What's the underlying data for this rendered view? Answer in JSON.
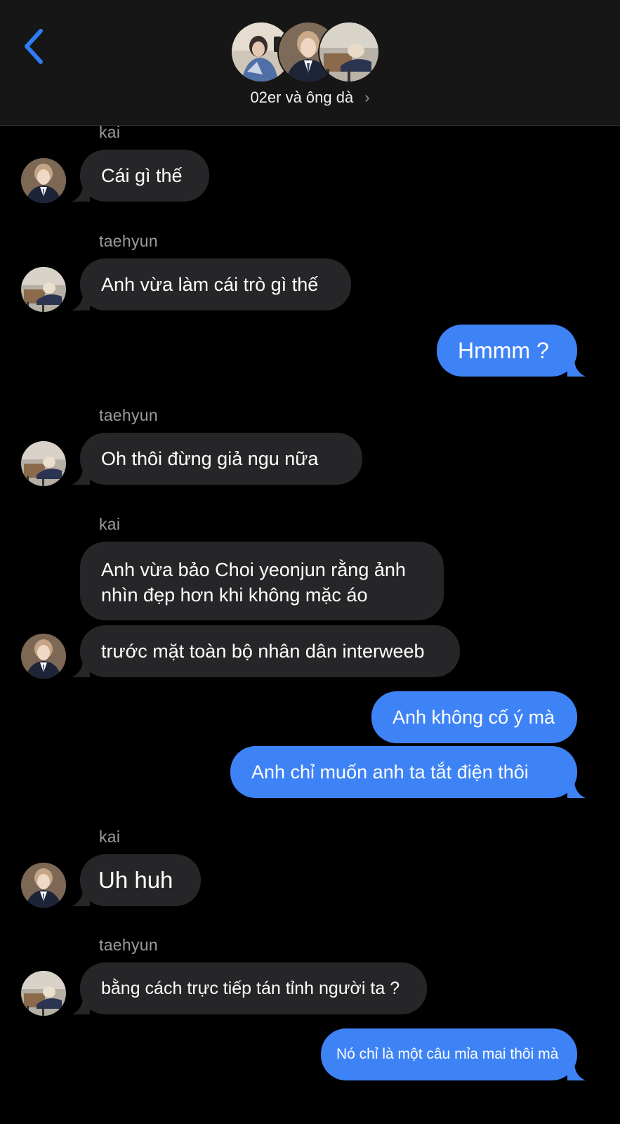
{
  "header": {
    "back_icon": "chevron-left-icon",
    "group_name": "02er và ông dà",
    "chevron": "›"
  },
  "colors": {
    "incoming_bubble": "#262629",
    "outgoing_bubble": "#3e83f6",
    "accent_back": "#2f7cf6"
  },
  "messages": {
    "m1": {
      "sender": "kai",
      "text": "Cái gì thế"
    },
    "m2": {
      "sender": "taehyun",
      "text": "Anh vừa làm cái trò gì thế"
    },
    "m3": {
      "text": "Hmmm ?"
    },
    "m4": {
      "sender": "taehyun",
      "text": "Oh thôi đừng giả ngu nữa"
    },
    "m5": {
      "sender": "kai",
      "line1": "Anh vừa bảo Choi yeonjun rằng ảnh",
      "line2": "nhìn đẹp hơn khi không mặc áo"
    },
    "m6": {
      "text": "trước mặt toàn bộ nhân dân interweeb"
    },
    "m7": {
      "text": "Anh không cố ý mà"
    },
    "m8": {
      "text": "Anh chỉ muốn anh ta tắt điện thôi"
    },
    "m9": {
      "sender": "kai",
      "text": "Uh huh"
    },
    "m10": {
      "sender": "taehyun",
      "text": "bằng cách trực tiếp tán tỉnh người ta ?"
    },
    "m11": {
      "text": "Nó chỉ là một câu mỉa mai thôi mà"
    }
  }
}
